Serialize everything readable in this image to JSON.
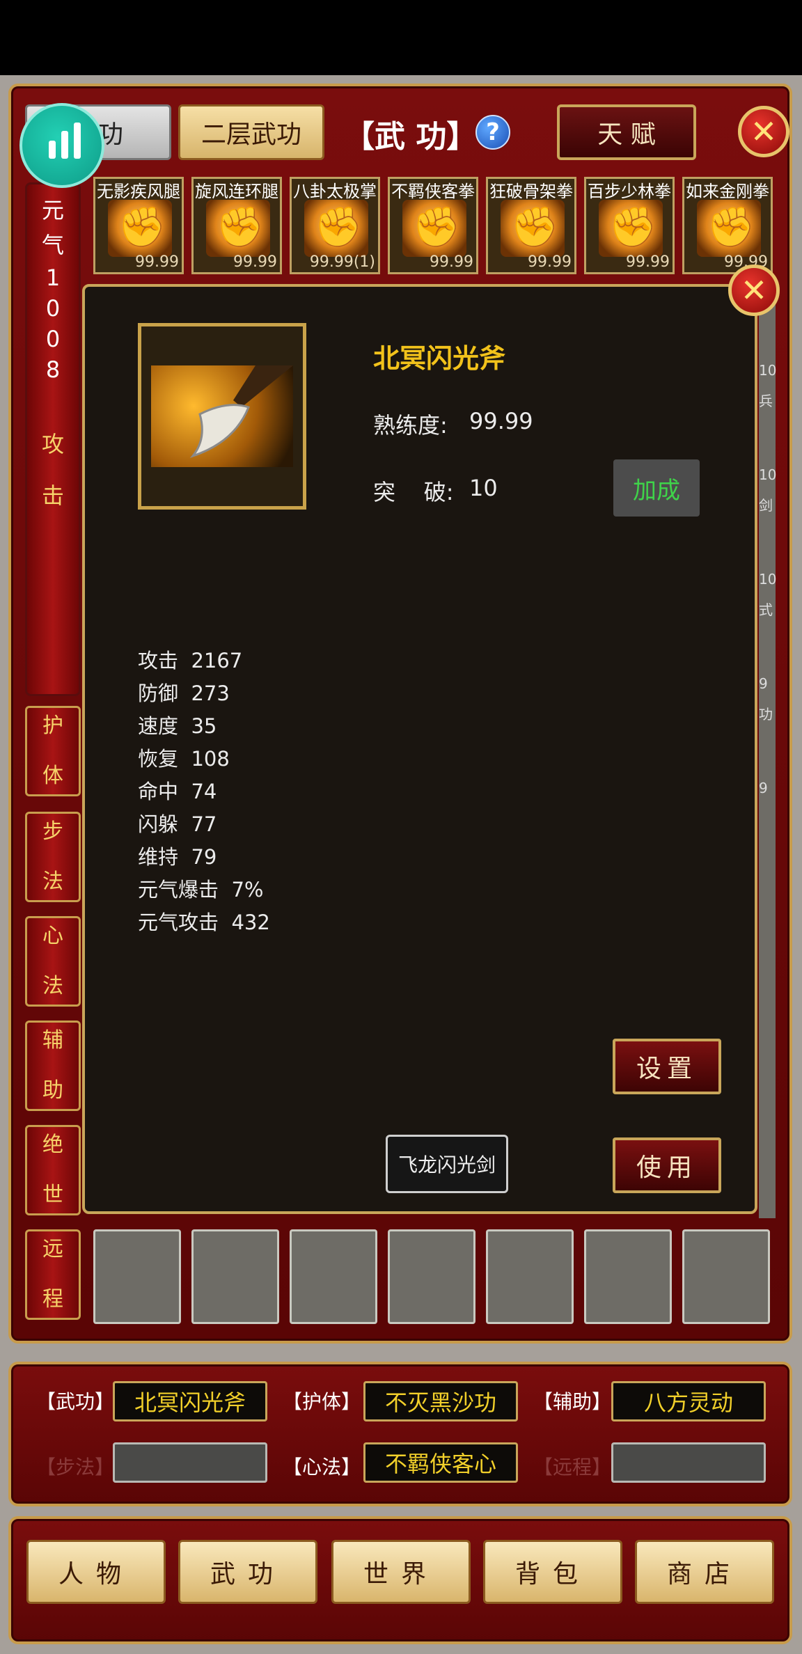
{
  "tabs": {
    "martial": "武功",
    "second_layer": "二层武功",
    "title": "【武  功】",
    "help": "?",
    "talent": "天 赋",
    "close": "✕"
  },
  "left_column": {
    "label_chars": [
      "元",
      "气",
      "1",
      "0",
      "0",
      "8"
    ],
    "attack_chars": [
      "攻",
      "击"
    ]
  },
  "side_tabs": [
    {
      "c1": "护",
      "c2": "体"
    },
    {
      "c1": "步",
      "c2": "法"
    },
    {
      "c1": "心",
      "c2": "法"
    },
    {
      "c1": "辅",
      "c2": "助"
    },
    {
      "c1": "绝",
      "c2": "世"
    },
    {
      "c1": "远",
      "c2": "程"
    }
  ],
  "skills": [
    {
      "name": "无影疾风腿",
      "value": "99.99"
    },
    {
      "name": "旋风连环腿",
      "value": "99.99"
    },
    {
      "name": "八卦太极掌",
      "value": "99.99(1)"
    },
    {
      "name": "不羁侠客拳",
      "value": "99.99"
    },
    {
      "name": "狂破骨架拳",
      "value": "99.99"
    },
    {
      "name": "百步少林拳",
      "value": "99.99"
    },
    {
      "name": "如来金刚拳",
      "value": "99.99"
    }
  ],
  "right_strip": [
    "10",
    "兵",
    "10",
    "剑",
    "10",
    "式",
    "9",
    "功",
    "9"
  ],
  "dialog": {
    "item_name": "北冥闪光斧",
    "proficiency_label": "熟练度:",
    "proficiency_value": "99.99",
    "break_label": "突    破:",
    "break_value": "10",
    "bonus_button": "加成",
    "stats": [
      {
        "label": "攻击",
        "value": "2167"
      },
      {
        "label": "防御",
        "value": "273"
      },
      {
        "label": "速度",
        "value": "35"
      },
      {
        "label": "恢复",
        "value": "108"
      },
      {
        "label": "命中",
        "value": "74"
      },
      {
        "label": "闪躲",
        "value": "77"
      },
      {
        "label": "维持",
        "value": "79"
      },
      {
        "label": "元气爆击",
        "value": "7%"
      },
      {
        "label": "元气攻击",
        "value": "432"
      }
    ],
    "settings_button": "设置",
    "use_button": "使用",
    "swap_button": "飞龙闪光剑",
    "close": "✕"
  },
  "equipped": {
    "row1": [
      {
        "label": "【武功】",
        "value": "北冥闪光斧"
      },
      {
        "label": "【护体】",
        "value": "不灭黑沙功"
      },
      {
        "label": "【辅助】",
        "value": "八方灵动"
      }
    ],
    "row2": [
      {
        "label": "【步法】",
        "value": ""
      },
      {
        "label": "【心法】",
        "value": "不羁侠客心"
      },
      {
        "label": "【远程】",
        "value": ""
      }
    ]
  },
  "nav": [
    "人物",
    "武功",
    "世界",
    "背包",
    "商店"
  ],
  "colors": {
    "accent_gold": "#c9a65a",
    "name_yellow": "#f2c21b",
    "bonus_green": "#3fd34a",
    "frame_red": "#7a0d0d"
  }
}
